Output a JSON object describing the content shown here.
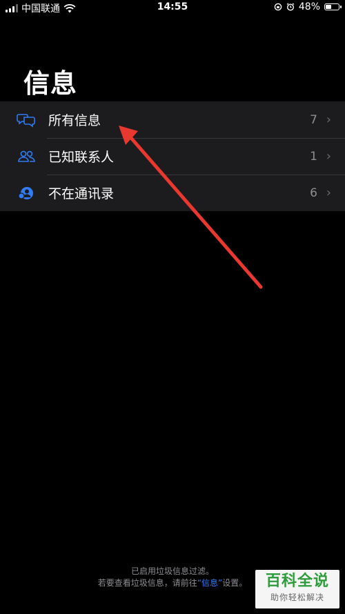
{
  "status_bar": {
    "carrier": "中国联通",
    "time": "14:55",
    "battery": "48%",
    "battery_level": 0.48
  },
  "header": {
    "title": "信息"
  },
  "filters": [
    {
      "label": "所有信息",
      "count": "7",
      "icon": "speech-bubbles-icon"
    },
    {
      "label": "已知联系人",
      "count": "1",
      "icon": "people-icon"
    },
    {
      "label": "不在通讯录",
      "count": "6",
      "icon": "unknown-person-icon"
    }
  ],
  "footer": {
    "line1": "已启用垃圾信息过滤。",
    "line2_prefix": "若要查看垃圾信息，请前往",
    "line2_link": "“信息”",
    "line2_suffix": "设置。"
  },
  "watermark": {
    "title": "百科全说",
    "subtitle": "助你轻松解决"
  },
  "colors": {
    "accent": "#2f7cf6",
    "background": "#000000",
    "cell": "#1c1c1e",
    "arrow": "#e8382f"
  }
}
